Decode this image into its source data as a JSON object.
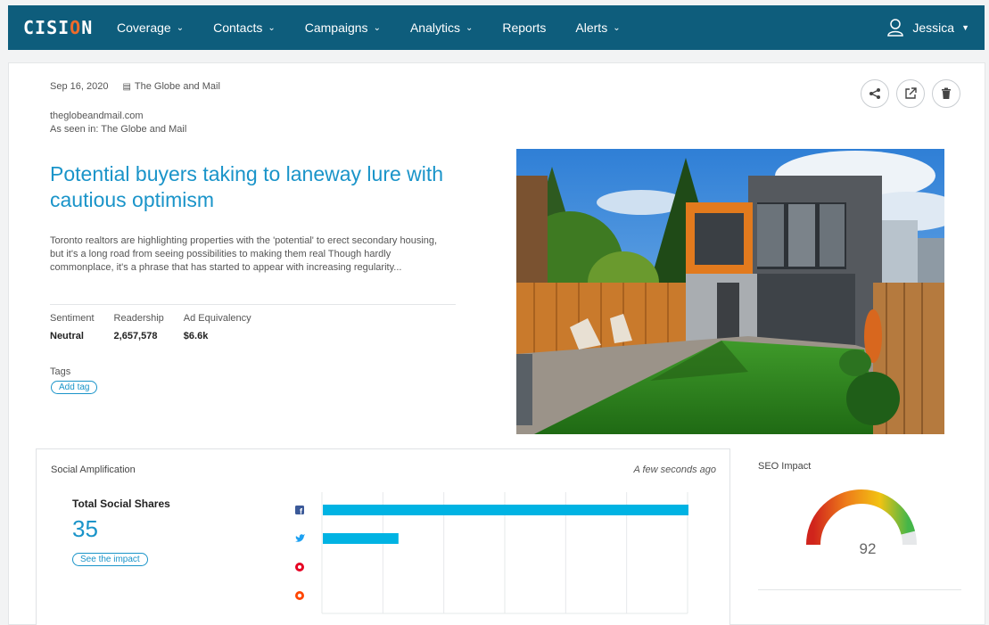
{
  "nav": {
    "logo_left": "CISI",
    "logo_o": "O",
    "logo_right": "N",
    "items": [
      {
        "label": "Coverage",
        "dropdown": true
      },
      {
        "label": "Contacts",
        "dropdown": true
      },
      {
        "label": "Campaigns",
        "dropdown": true
      },
      {
        "label": "Analytics",
        "dropdown": true
      },
      {
        "label": "Reports",
        "dropdown": false
      },
      {
        "label": "Alerts",
        "dropdown": true
      }
    ],
    "user": "Jessica",
    "bg_color": "#0e5d7c"
  },
  "article": {
    "date": "Sep 16, 2020",
    "source": "The Globe and Mail",
    "domain": "theglobeandmail.com",
    "seen_in": "As seen in: The Globe and Mail",
    "headline": "Potential buyers taking to laneway lure with cautious optimism",
    "summary": "Toronto realtors are highlighting properties with the 'potential' to erect secondary housing, but it's a long road from seeing possibilities to making them real Though hardly commonplace, it's a phrase that has started to appear with increasing regularity...",
    "stats": [
      {
        "label": "Sentiment",
        "value": "Neutral"
      },
      {
        "label": "Readership",
        "value": "2,657,578"
      },
      {
        "label": "Ad Equivalency",
        "value": "$6.6k"
      }
    ],
    "tags_label": "Tags",
    "add_tag": "Add tag",
    "accent_color": "#1a94c9"
  },
  "actions": {
    "icons": [
      "share-icon",
      "external-link-icon",
      "trash-icon"
    ]
  },
  "social": {
    "title": "Social Amplification",
    "updated": "A few seconds ago",
    "total_label": "Total Social Shares",
    "total_value": "35",
    "impact_button": "See the impact"
  },
  "chart_data": {
    "type": "bar",
    "orientation": "horizontal",
    "categories": [
      "Facebook",
      "Twitter",
      "Pinterest",
      "Reddit"
    ],
    "values": [
      29,
      6,
      0,
      0
    ],
    "xlim": [
      0,
      29
    ],
    "grid": true,
    "bar_color": "#00b3e3"
  },
  "seo": {
    "title": "SEO Impact",
    "score": 92,
    "score_text": "92"
  }
}
